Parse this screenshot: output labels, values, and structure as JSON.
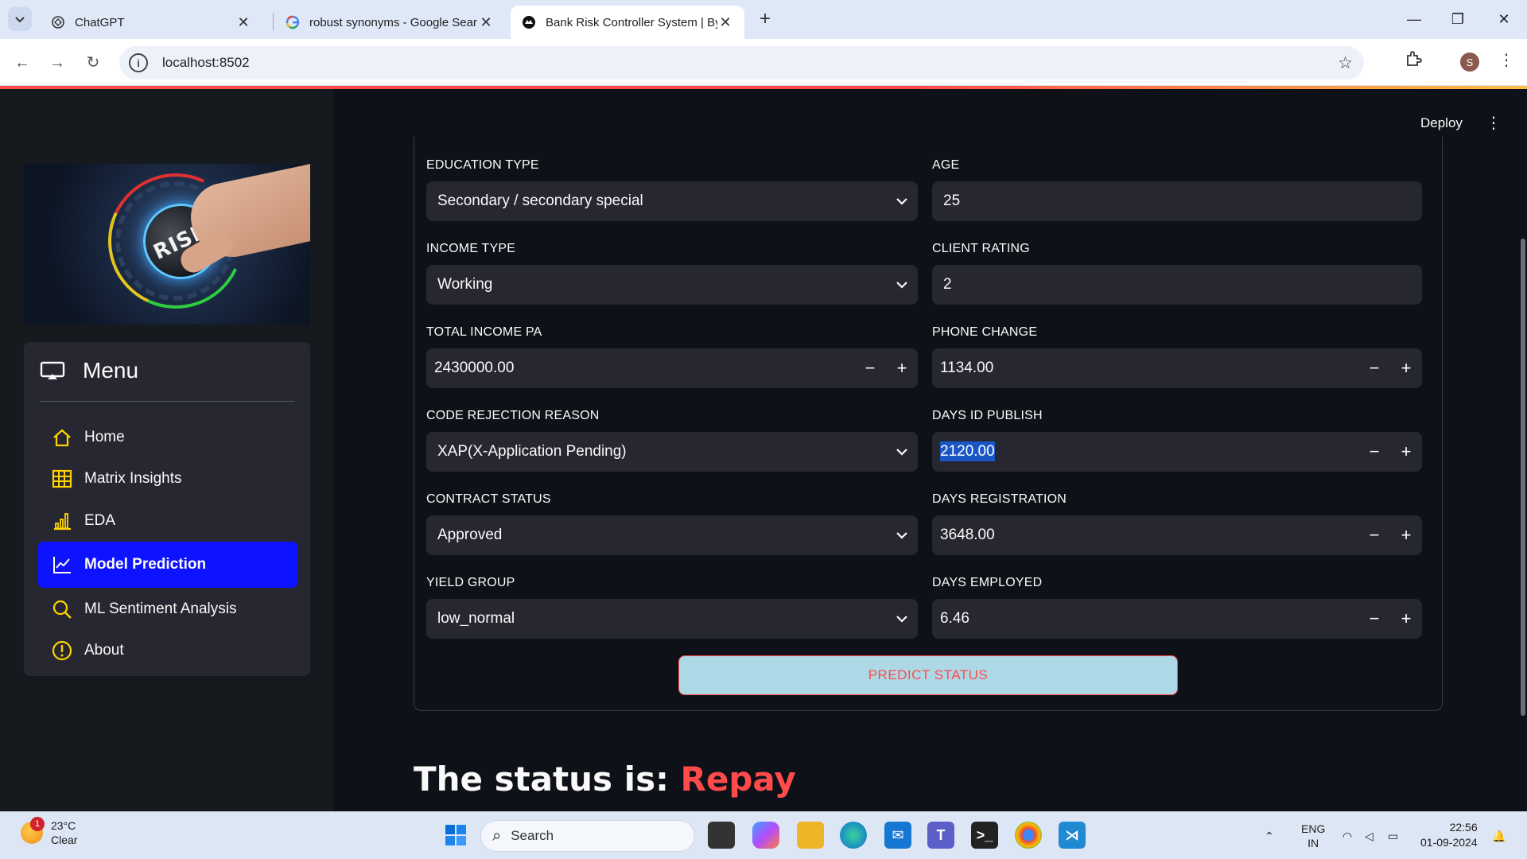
{
  "browser": {
    "tabs": [
      {
        "title": "ChatGPT",
        "icon": "chatgpt-icon"
      },
      {
        "title": "robust synonyms - Google Sear",
        "icon": "google-icon"
      },
      {
        "title": "Bank Risk Controller System | By",
        "icon": "streamlit-icon",
        "active": true
      }
    ],
    "url": "localhost:8502",
    "profile_initial": "S"
  },
  "app": {
    "deploy_label": "Deploy",
    "hero_text": "RISK",
    "menu": {
      "title": "Menu",
      "items": [
        {
          "label": "Home",
          "icon": "home-icon"
        },
        {
          "label": "Matrix Insights",
          "icon": "table-icon"
        },
        {
          "label": "EDA",
          "icon": "bar-chart-icon"
        },
        {
          "label": "Model Prediction",
          "icon": "line-chart-icon",
          "active": true
        },
        {
          "label": "ML Sentiment Analysis",
          "icon": "search-icon"
        },
        {
          "label": "About",
          "icon": "info-icon"
        }
      ]
    },
    "form": {
      "education_type": {
        "label": "EDUCATION TYPE",
        "value": "Secondary / secondary special"
      },
      "age": {
        "label": "AGE",
        "value": "25"
      },
      "income_type": {
        "label": "INCOME TYPE",
        "value": "Working"
      },
      "client_rating": {
        "label": "CLIENT RATING",
        "value": "2"
      },
      "total_income": {
        "label": "TOTAL INCOME PA",
        "value": "2430000.00"
      },
      "phone_change": {
        "label": "PHONE CHANGE",
        "value": "1134.00"
      },
      "code_rejection": {
        "label": "CODE REJECTION REASON",
        "value": "XAP(X-Application Pending)"
      },
      "days_id_publish": {
        "label": "DAYS ID PUBLISH",
        "value": "2120.00"
      },
      "contract_status": {
        "label": "CONTRACT STATUS",
        "value": "Approved"
      },
      "days_registration": {
        "label": "DAYS REGISTRATION",
        "value": "3648.00"
      },
      "yield_group": {
        "label": "YIELD GROUP",
        "value": "low_normal"
      },
      "days_employed": {
        "label": "DAYS EMPLOYED",
        "value": "6.46"
      },
      "stepper_minus": "−",
      "stepper_plus": "+",
      "predict_button": "PREDICT STATUS"
    },
    "result": {
      "prefix": "The status is:",
      "value": "Repay"
    }
  },
  "taskbar": {
    "weather_temp": "23°C",
    "weather_desc": "Clear",
    "weather_badge": "1",
    "search_placeholder": "Search",
    "lang_top": "ENG",
    "lang_bottom": "IN",
    "time": "22:56",
    "date": "01-09-2024"
  },
  "colors": {
    "accent_red": "#ff4b4b",
    "active_menu": "#0d12ff",
    "predict_bg": "#add8e6",
    "menu_icon_yellow": "#ffd400"
  }
}
